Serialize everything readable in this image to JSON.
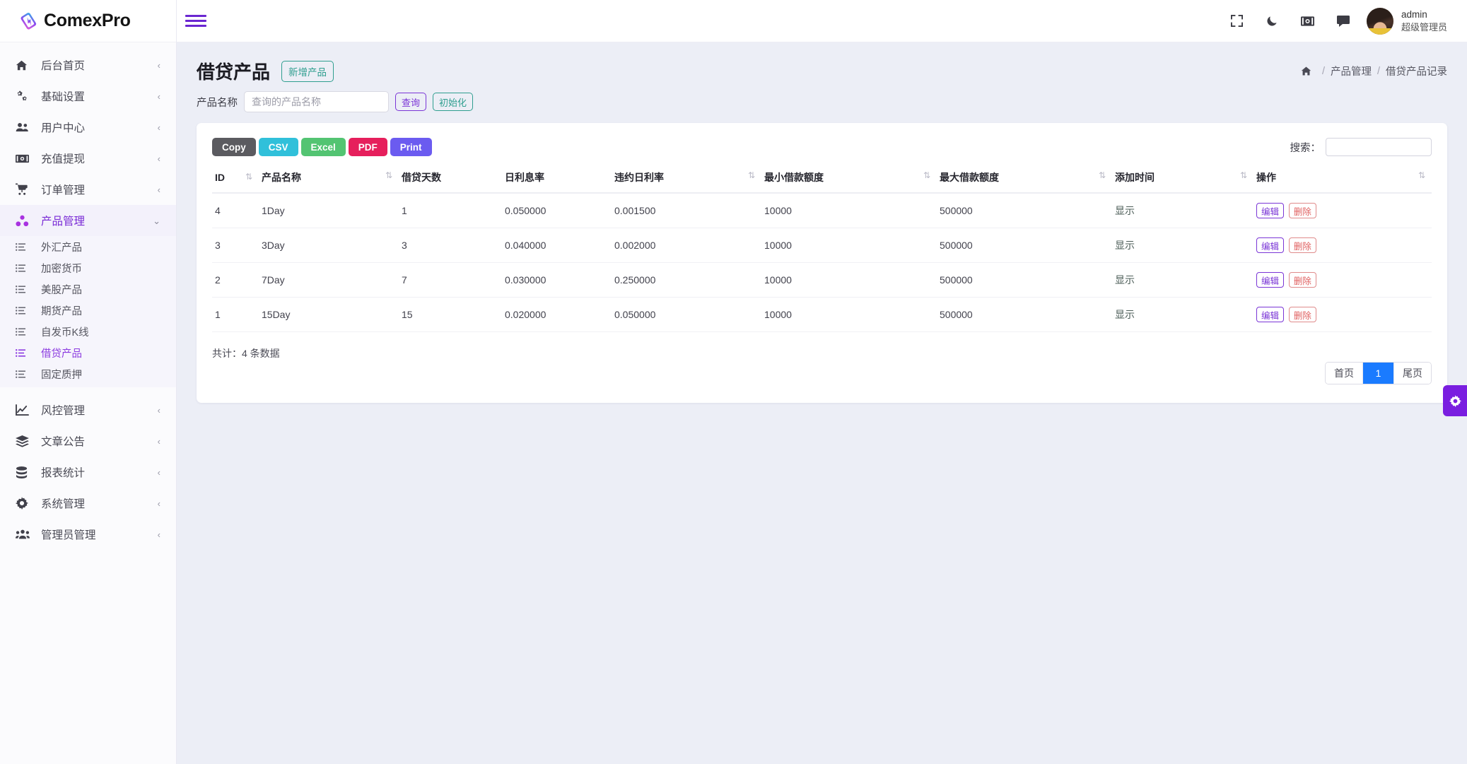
{
  "brand": {
    "name": "ComexPro"
  },
  "topbar": {
    "icons": [
      {
        "name": "fullscreen-icon",
        "label": "fullscreen"
      },
      {
        "name": "dark-mode-icon",
        "label": "dark mode"
      },
      {
        "name": "cash-icon",
        "label": "cash"
      },
      {
        "name": "message-icon",
        "label": "messages"
      }
    ],
    "user": {
      "name": "admin",
      "role": "超级管理员"
    }
  },
  "sidebar": {
    "items": [
      {
        "label": "后台首页",
        "icon": "home-icon",
        "caret": "‹"
      },
      {
        "label": "基础设置",
        "icon": "cogs-icon",
        "caret": "‹"
      },
      {
        "label": "用户中心",
        "icon": "users-icon",
        "caret": "‹"
      },
      {
        "label": "充值提现",
        "icon": "money-icon",
        "caret": "‹"
      },
      {
        "label": "订单管理",
        "icon": "cart-icon",
        "caret": "‹"
      },
      {
        "label": "产品管理",
        "icon": "molecule-icon",
        "caret": "⌄",
        "open": true
      },
      {
        "label": "风控管理",
        "icon": "chart-line-icon",
        "caret": "‹"
      },
      {
        "label": "文章公告",
        "icon": "layers-icon",
        "caret": "‹"
      },
      {
        "label": "报表统计",
        "icon": "coins-icon",
        "caret": "‹"
      },
      {
        "label": "系统管理",
        "icon": "gear-icon",
        "caret": "‹"
      },
      {
        "label": "管理员管理",
        "icon": "user-group-icon",
        "caret": "‹"
      }
    ],
    "submenu": [
      {
        "label": "外汇产品",
        "active": false
      },
      {
        "label": "加密货币",
        "active": false
      },
      {
        "label": "美股产品",
        "active": false
      },
      {
        "label": "期货产品",
        "active": false
      },
      {
        "label": "自发币K线",
        "active": false
      },
      {
        "label": "借贷产品",
        "active": true
      },
      {
        "label": "固定质押",
        "active": false
      }
    ]
  },
  "page": {
    "title": "借贷产品",
    "new_badge": "新增产品",
    "breadcrumb": {
      "home_icon": "home-icon",
      "sep": "/",
      "items": [
        "产品管理",
        "借贷产品记录"
      ]
    },
    "filter": {
      "label": "产品名称",
      "input_placeholder": "查询的产品名称",
      "input_value": "",
      "query_button": "查询",
      "reset_button": "初始化"
    }
  },
  "card": {
    "export_buttons": [
      {
        "id": "dt-copy",
        "label": "Copy",
        "color": "#5b5b60"
      },
      {
        "id": "dt-csv",
        "label": "CSV",
        "color": "#30c0da"
      },
      {
        "id": "dt-excel",
        "label": "Excel",
        "color": "#53c472"
      },
      {
        "id": "dt-pdf",
        "label": "PDF",
        "color": "#e61f5c"
      },
      {
        "id": "dt-print",
        "label": "Print",
        "color": "#6b5bf0"
      }
    ],
    "search": {
      "label": "搜索：",
      "value": "",
      "placeholder": ""
    },
    "columns": [
      "ID",
      "产品名称",
      "借贷天数",
      "日利息率",
      "违约日利率",
      "最小借款额度",
      "最大借款额度",
      "添加时间",
      "操作"
    ],
    "sort_glyph": "⇅",
    "rows": [
      {
        "id": "4",
        "name": "1Day",
        "days": "1",
        "daily_rate": "0.050000",
        "penalty_rate": "0.001500",
        "min_amount": "10000",
        "max_amount": "500000",
        "add_time": "显示",
        "edit": "编辑",
        "delete": "删除"
      },
      {
        "id": "3",
        "name": "3Day",
        "days": "3",
        "daily_rate": "0.040000",
        "penalty_rate": "0.002000",
        "min_amount": "10000",
        "max_amount": "500000",
        "add_time": "显示",
        "edit": "编辑",
        "delete": "删除"
      },
      {
        "id": "2",
        "name": "7Day",
        "days": "7",
        "daily_rate": "0.030000",
        "penalty_rate": "0.250000",
        "min_amount": "10000",
        "max_amount": "500000",
        "add_time": "显示",
        "edit": "编辑",
        "delete": "删除"
      },
      {
        "id": "1",
        "name": "15Day",
        "days": "15",
        "daily_rate": "0.020000",
        "penalty_rate": "0.050000",
        "min_amount": "10000",
        "max_amount": "500000",
        "add_time": "显示",
        "edit": "编辑",
        "delete": "删除"
      }
    ],
    "total_text": "共计：4 条数据",
    "pager": [
      {
        "label": "首页",
        "active": false
      },
      {
        "label": "1",
        "active": true
      },
      {
        "label": "尾页",
        "active": false
      }
    ]
  },
  "float": {
    "gear_icon": "gear-icon"
  },
  "colors": {
    "accent_purple": "#7a35d6",
    "accent_teal": "#2f9e8f",
    "page_bg": "#eceef6",
    "pager_active": "#1a7bff",
    "hamburger": "#6a26d1"
  }
}
